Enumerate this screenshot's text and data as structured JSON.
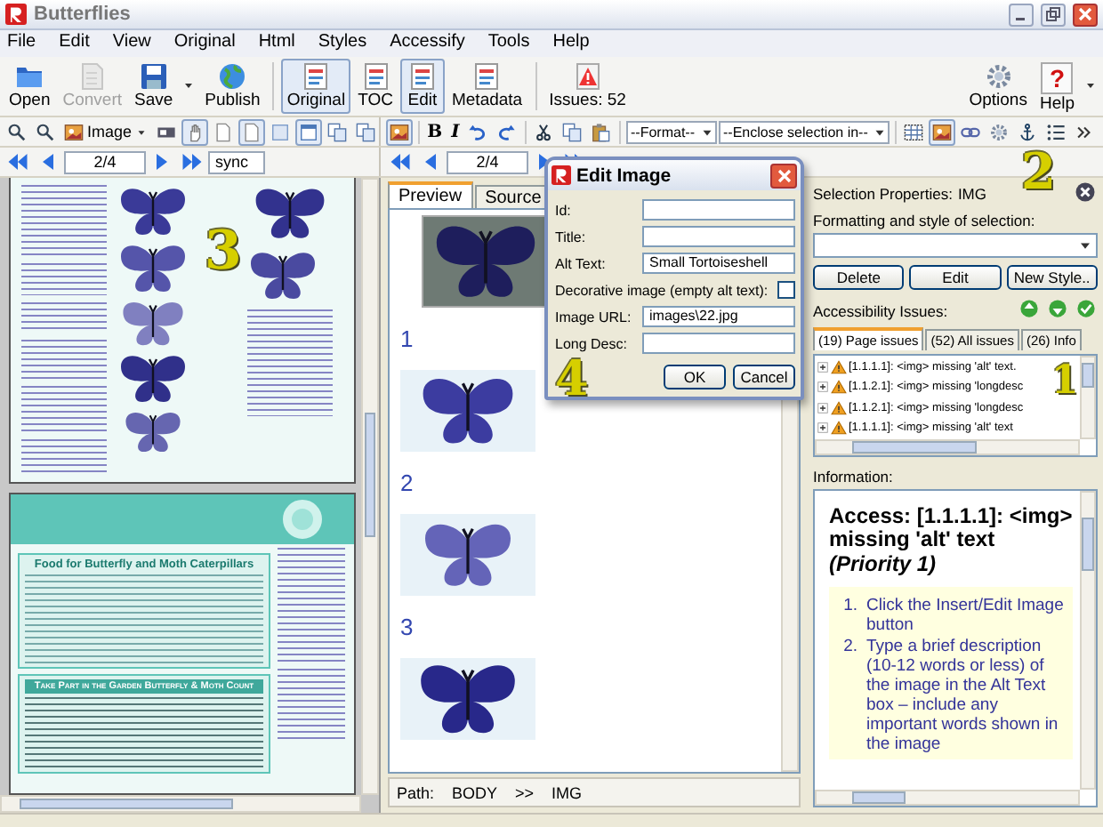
{
  "window": {
    "title": "Butterflies"
  },
  "menu": [
    "File",
    "Edit",
    "View",
    "Original",
    "Html",
    "Styles",
    "Accessify",
    "Tools",
    "Help"
  ],
  "main_toolbar": [
    {
      "label": "Open",
      "pressed": false,
      "disabled": false
    },
    {
      "label": "Convert",
      "pressed": false,
      "disabled": true
    },
    {
      "label": "Save",
      "pressed": false,
      "disabled": false
    },
    {
      "label": "Publish",
      "pressed": false,
      "disabled": false
    },
    {
      "label": "Original",
      "pressed": true,
      "disabled": false
    },
    {
      "label": "TOC",
      "pressed": false,
      "disabled": false
    },
    {
      "label": "Edit",
      "pressed": true,
      "disabled": false
    },
    {
      "label": "Metadata",
      "pressed": false,
      "disabled": false
    },
    {
      "label": "Issues: 52",
      "pressed": false,
      "disabled": false
    }
  ],
  "right_toolbar": [
    {
      "label": "Options"
    },
    {
      "label": "Help",
      "glyph": "?"
    }
  ],
  "format_toolbar": {
    "image_menu": "Image",
    "bold": "B",
    "italic": "I",
    "format_select": "--Format--",
    "enclose_select": "--Enclose selection in--"
  },
  "page_navigator": {
    "page": "2/4",
    "sync": "sync"
  },
  "preview_navigator": {
    "page": "2/4"
  },
  "document": {
    "headings": [
      "Food for Butterfly and Moth Caterpillars",
      "Take Part in the Garden Butterfly & Moth Count"
    ]
  },
  "preview": {
    "tabs": [
      {
        "label": "Preview",
        "selected": true
      },
      {
        "label": "Source",
        "selected": false
      }
    ],
    "figure_numbers": [
      "1",
      "2",
      "3"
    ],
    "path": {
      "label": "Path:",
      "items": [
        "BODY",
        ">>",
        "IMG"
      ]
    }
  },
  "edit_dialog": {
    "title": "Edit Image",
    "fields": [
      {
        "kind": "text",
        "label": "Id:"
      },
      {
        "kind": "text",
        "label": "Title:"
      },
      {
        "kind": "text",
        "label": "Alt Text:",
        "value": "Small Tortoiseshell"
      },
      {
        "kind": "checkbox",
        "label": "Decorative image (empty alt text):",
        "checked": false
      },
      {
        "kind": "text",
        "label": "Image URL:",
        "value": "images\\22.jpg"
      },
      {
        "kind": "text",
        "label": "Long Desc:"
      }
    ],
    "buttons": [
      "OK",
      "Cancel"
    ]
  },
  "properties": {
    "selection_label": "Selection Properties:",
    "selection_value": "IMG",
    "style_label": "Formatting and style of selection:",
    "buttons": [
      "Delete",
      "Edit",
      "New Style.."
    ],
    "issues_label": "Accessibility Issues:",
    "issue_tabs": [
      {
        "label": "(19) Page issues",
        "selected": true
      },
      {
        "label": "(52) All issues",
        "selected": false
      },
      {
        "label": "(26) Info",
        "selected": false
      }
    ],
    "issues": [
      "[1.1.1.1]: <img> missing 'alt' text.",
      "[1.1.2.1]: <img> missing 'longdesc",
      "[1.1.2.1]: <img> missing 'longdesc",
      "[1.1.1.1]: <img> missing 'alt' text"
    ],
    "information_label": "Information:",
    "information": {
      "title": "Access: [1.1.1.1]: <img> missing 'alt' text",
      "priority": "(Priority 1)",
      "steps": [
        {
          "number": "1.",
          "text": "Click the Insert/Edit Image button"
        },
        {
          "number": "2.",
          "text": "Type a brief description (10-12 words or less) of the image in the Alt Text box – include any important words shown in the image"
        }
      ]
    }
  },
  "callouts": [
    "1",
    "2",
    "3",
    "4"
  ]
}
